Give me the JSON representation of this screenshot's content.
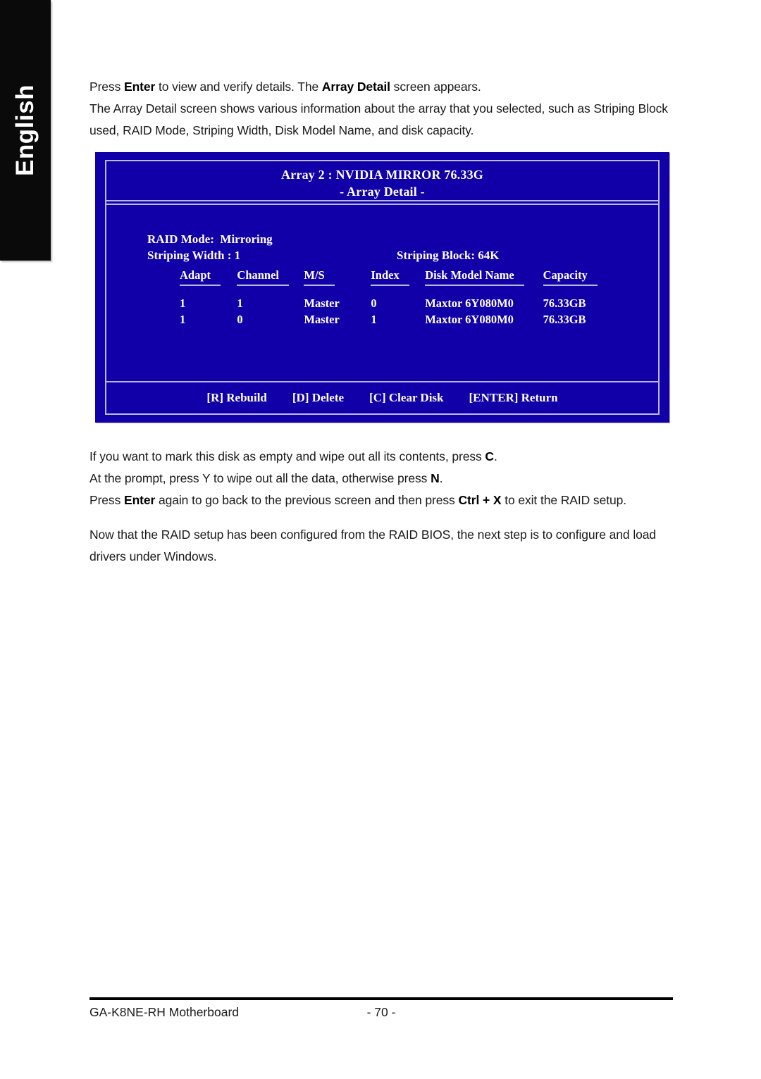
{
  "sidebar": {
    "language_tab": "English"
  },
  "content": {
    "intro": {
      "line1_pre": "Press ",
      "line1_b1": "Enter",
      "line1_mid": " to view and verify details. The ",
      "line1_b2": "Array Detail",
      "line1_post": " screen appears.",
      "line2": "The Array Detail screen shows various information about the array that you selected, such as Striping Block used, RAID Mode, Striping Width, Disk Model Name, and disk capacity."
    },
    "after": {
      "line1_pre": "If you want to mark this disk as empty and wipe out all its contents, press ",
      "line1_b1": "C",
      "line1_post": ".",
      "line2_pre": "At the prompt, press Y to wipe out all the data, otherwise press ",
      "line2_b1": "N",
      "line2_post": ".",
      "line3_pre": "Press ",
      "line3_b1": "Enter",
      "line3_mid": " again to go back to the previous screen and then press ",
      "line3_b2": "Ctrl + X",
      "line3_post": " to exit the RAID setup."
    },
    "final": {
      "line1": "Now that the RAID setup has been configured from the RAID BIOS, the next step is to configure and load drivers under Windows."
    }
  },
  "bios": {
    "title_line1": "Array 2 : NVIDIA MIRROR 76.33G",
    "title_line2": "- Array Detail -",
    "raid_mode_label": "RAID Mode:",
    "raid_mode_value": "Mirroring",
    "striping_width_label": "Striping Width :",
    "striping_width_value": "1",
    "striping_block_label": "Striping Block:",
    "striping_block_value": "64K",
    "table": {
      "headers": [
        "Adapt",
        "Channel",
        "M/S",
        "Index",
        "Disk Model Name",
        "Capacity"
      ],
      "rows": [
        [
          "1",
          "1",
          "Master",
          "0",
          "Maxtor 6Y080M0",
          "76.33GB"
        ],
        [
          "1",
          "0",
          "Master",
          "1",
          "Maxtor 6Y080M0",
          "76.33GB"
        ]
      ]
    },
    "commands": [
      "[R] Rebuild",
      "[D] Delete",
      "[C] Clear Disk",
      "[ENTER] Return"
    ],
    "colors": {
      "background": "#1100a8",
      "border": "#b9b9e8",
      "text": "#ffffff"
    }
  },
  "footer": {
    "model": "GA-K8NE-RH Motherboard",
    "page_number": "- 70 -"
  }
}
